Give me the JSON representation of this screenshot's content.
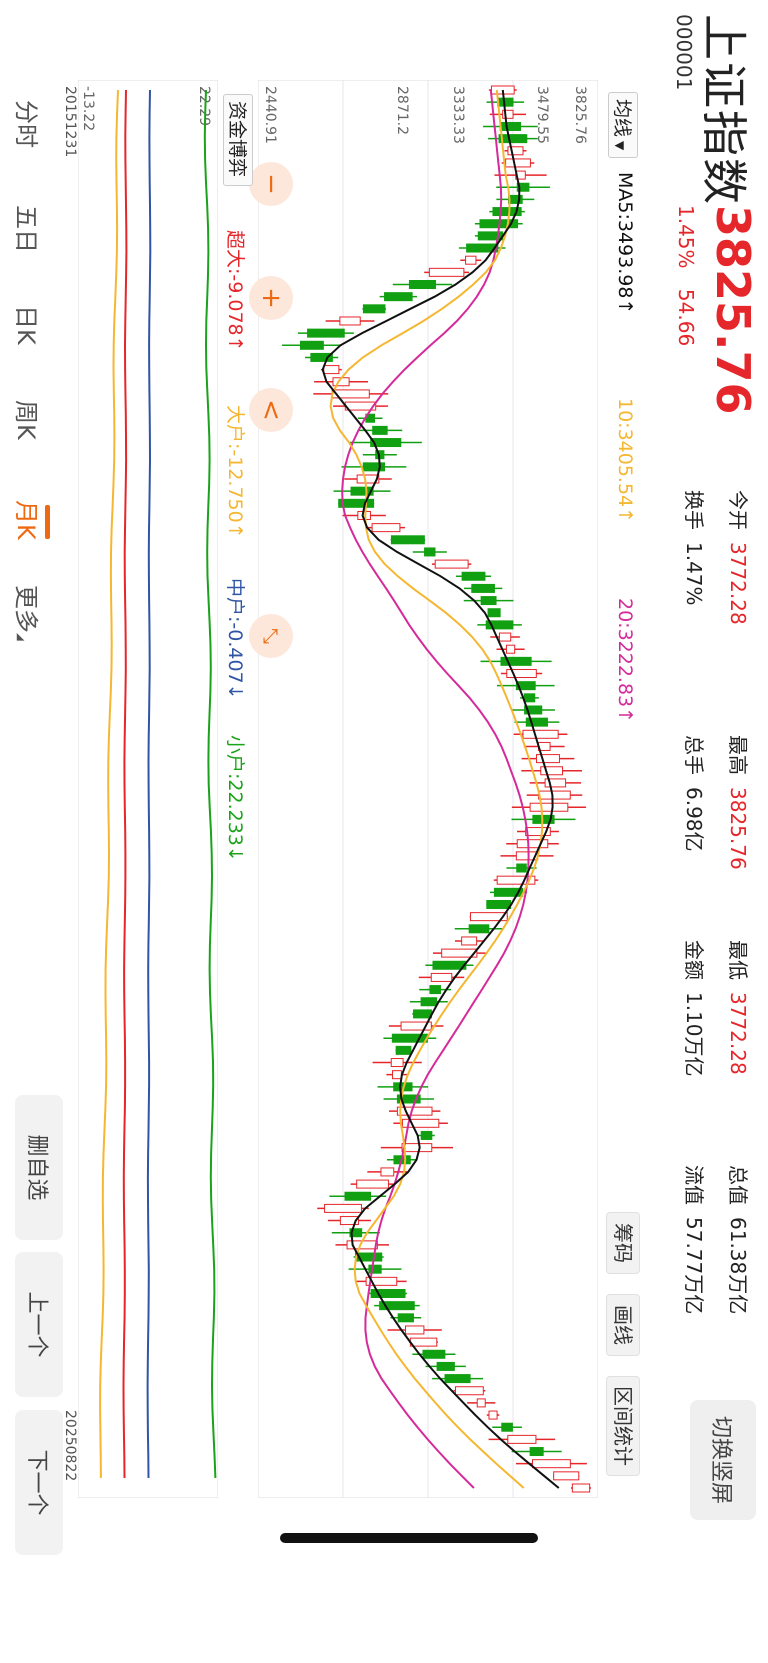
{
  "header": {
    "name": "上证指数",
    "code": "000001",
    "price": "3825.76",
    "change_pct": "1.45%",
    "change_pts": "54.66",
    "stats": [
      {
        "label": "今开",
        "value": "3772.28",
        "red": true
      },
      {
        "label": "最高",
        "value": "3825.76",
        "red": true
      },
      {
        "label": "最低",
        "value": "3772.28",
        "red": true
      },
      {
        "label": "总值",
        "value": "61.38万亿",
        "red": false
      },
      {
        "label": "换手",
        "value": "1.47%",
        "red": false
      },
      {
        "label": "总手",
        "value": "6.98亿",
        "red": false
      },
      {
        "label": "金额",
        "value": "1.10万亿",
        "red": false
      },
      {
        "label": "流值",
        "value": "57.77万亿",
        "red": false
      }
    ],
    "switch_label": "切换竖屏"
  },
  "ma_bar": {
    "selector": "均线",
    "ma5": "MA5:3493.98↑",
    "ma10": "10:3405.54↑",
    "ma20": "20:3222.83↑",
    "colors": {
      "ma5": "#111111",
      "ma10": "#f5b731",
      "ma20": "#d42a9a"
    }
  },
  "tools": [
    "筹码",
    "画线",
    "区间统计"
  ],
  "kline": {
    "top_label": "3825.76",
    "high_label": "3479.55",
    "mid_label": "3333.33",
    "low_mark": "2871.2",
    "bottom_label": "2440.91"
  },
  "fund": {
    "selector": "资金博弈",
    "items": [
      {
        "label": "超大:-9.078↑",
        "color": "#e5262a"
      },
      {
        "label": "大户:-12.750↑",
        "color": "#f5b731"
      },
      {
        "label": "中户:-0.407↓",
        "color": "#2f55a4"
      },
      {
        "label": "小户:22.233↓",
        "color": "#1aa31a"
      }
    ],
    "top_label": "22.29",
    "bottom_label": "-13.22"
  },
  "dates": {
    "start": "20151231",
    "end": "20250822"
  },
  "period_tabs": [
    "分时",
    "五日",
    "日K",
    "周K",
    "月K",
    "更多"
  ],
  "active_tab": 4,
  "side_buttons": [
    "删自选",
    "上一个",
    "下一个"
  ],
  "colors": {
    "up": "#e5262a",
    "down": "#11a011",
    "accent": "#ee6a12"
  }
}
